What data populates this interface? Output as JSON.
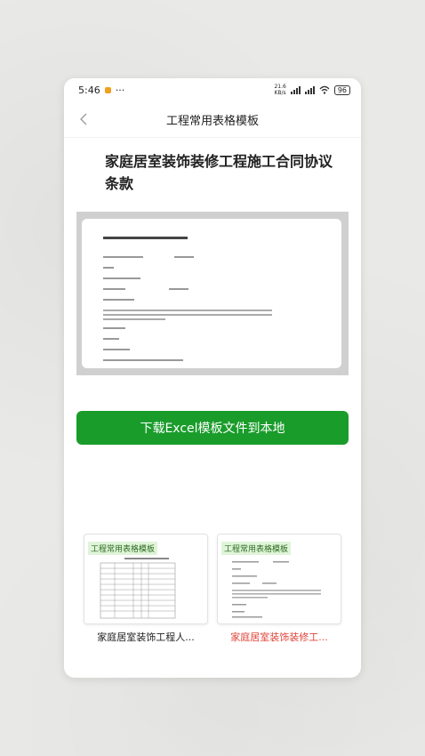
{
  "status_bar": {
    "time": "5:46",
    "dots": "···",
    "network_speed": "21.6\nKB/s",
    "battery": "96"
  },
  "header": {
    "title": "工程常用表格模板"
  },
  "document": {
    "title": "家庭居室装饰装修工程施工合同协议条款"
  },
  "download_button": {
    "label": "下载Excel模板文件到本地"
  },
  "related": [
    {
      "tag": "工程常用表格模板",
      "title": "家庭居室装饰工程人...",
      "title_color": "#222222"
    },
    {
      "tag": "工程常用表格模板",
      "title": "家庭居室装饰装修工...",
      "title_color": "#e0443a"
    }
  ],
  "colors": {
    "accent_green": "#1a9c2b",
    "highlight_red": "#e0443a"
  }
}
